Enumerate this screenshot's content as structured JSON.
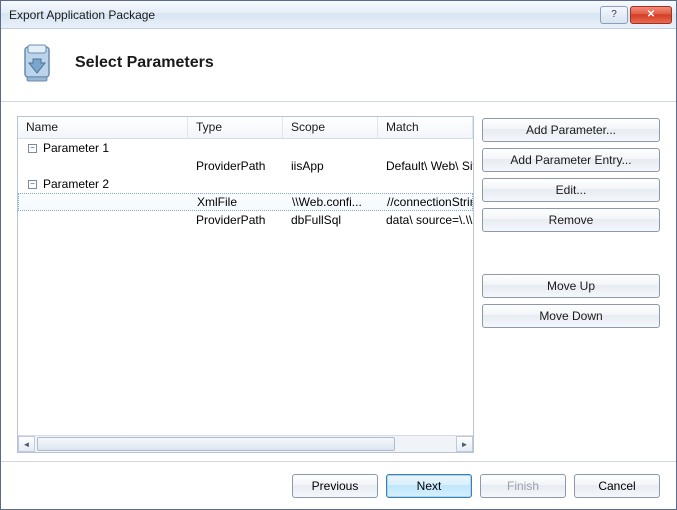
{
  "window": {
    "title": "Export Application Package"
  },
  "header": {
    "title": "Select Parameters"
  },
  "columns": {
    "name": "Name",
    "type": "Type",
    "scope": "Scope",
    "match": "Match"
  },
  "rows": [
    {
      "kind": "group",
      "expanded": true,
      "name": "Parameter 1",
      "type": "",
      "scope": "",
      "match": ""
    },
    {
      "kind": "child",
      "name": "",
      "type": "ProviderPath",
      "scope": "iisApp",
      "match": "Default\\ Web\\ Site/M"
    },
    {
      "kind": "group",
      "expanded": true,
      "name": "Parameter 2",
      "type": "",
      "scope": "",
      "match": ""
    },
    {
      "kind": "child",
      "selected": true,
      "name": "",
      "type": "XmlFile",
      "scope": "\\\\Web.confi...",
      "match": "//connectionStrings/"
    },
    {
      "kind": "child",
      "name": "",
      "type": "ProviderPath",
      "scope": "dbFullSql",
      "match": "data\\ source=\\.\\\\SQ"
    }
  ],
  "buttons": {
    "add_parameter": "Add Parameter...",
    "add_entry": "Add Parameter Entry...",
    "edit": "Edit...",
    "remove": "Remove",
    "move_up": "Move Up",
    "move_down": "Move Down"
  },
  "footer": {
    "previous": "Previous",
    "next": "Next",
    "finish": "Finish",
    "cancel": "Cancel"
  },
  "titlebar_icons": {
    "help": "?",
    "close": "✕"
  }
}
